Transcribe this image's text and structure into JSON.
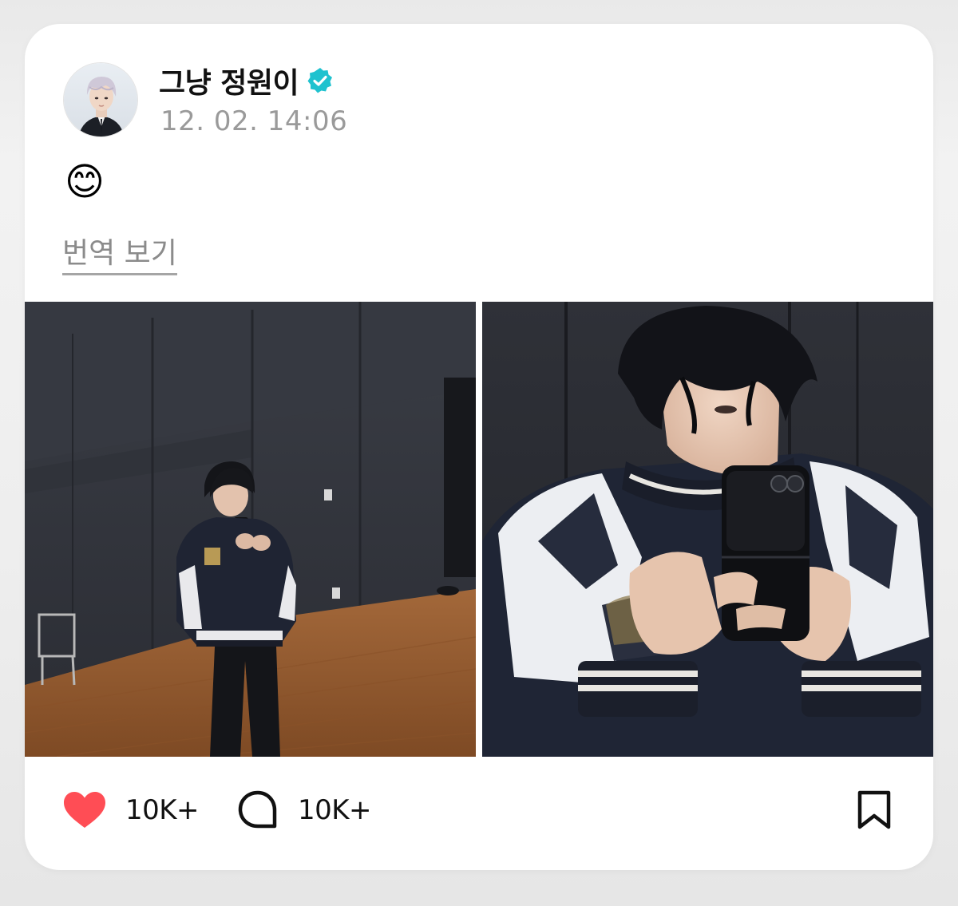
{
  "post": {
    "author_name": "그냥 정원이",
    "verified": true,
    "timestamp": "12. 02. 14:06",
    "text": "😊",
    "translate_label": "번역 보기",
    "images": [
      {
        "alt": "Full-body mirror selfie in a dance practice room"
      },
      {
        "alt": "Close-up mirror selfie holding a phone"
      }
    ]
  },
  "actions": {
    "like_count": "10K+",
    "comment_count": "10K+"
  },
  "colors": {
    "like": "#ff4d55",
    "verified": "#1fc2cf",
    "timestamp": "#9a9a9a",
    "link": "#8b8b8b"
  },
  "icons": [
    "verified-badge-icon",
    "heart-icon",
    "comment-bubble-icon",
    "bookmark-icon"
  ]
}
